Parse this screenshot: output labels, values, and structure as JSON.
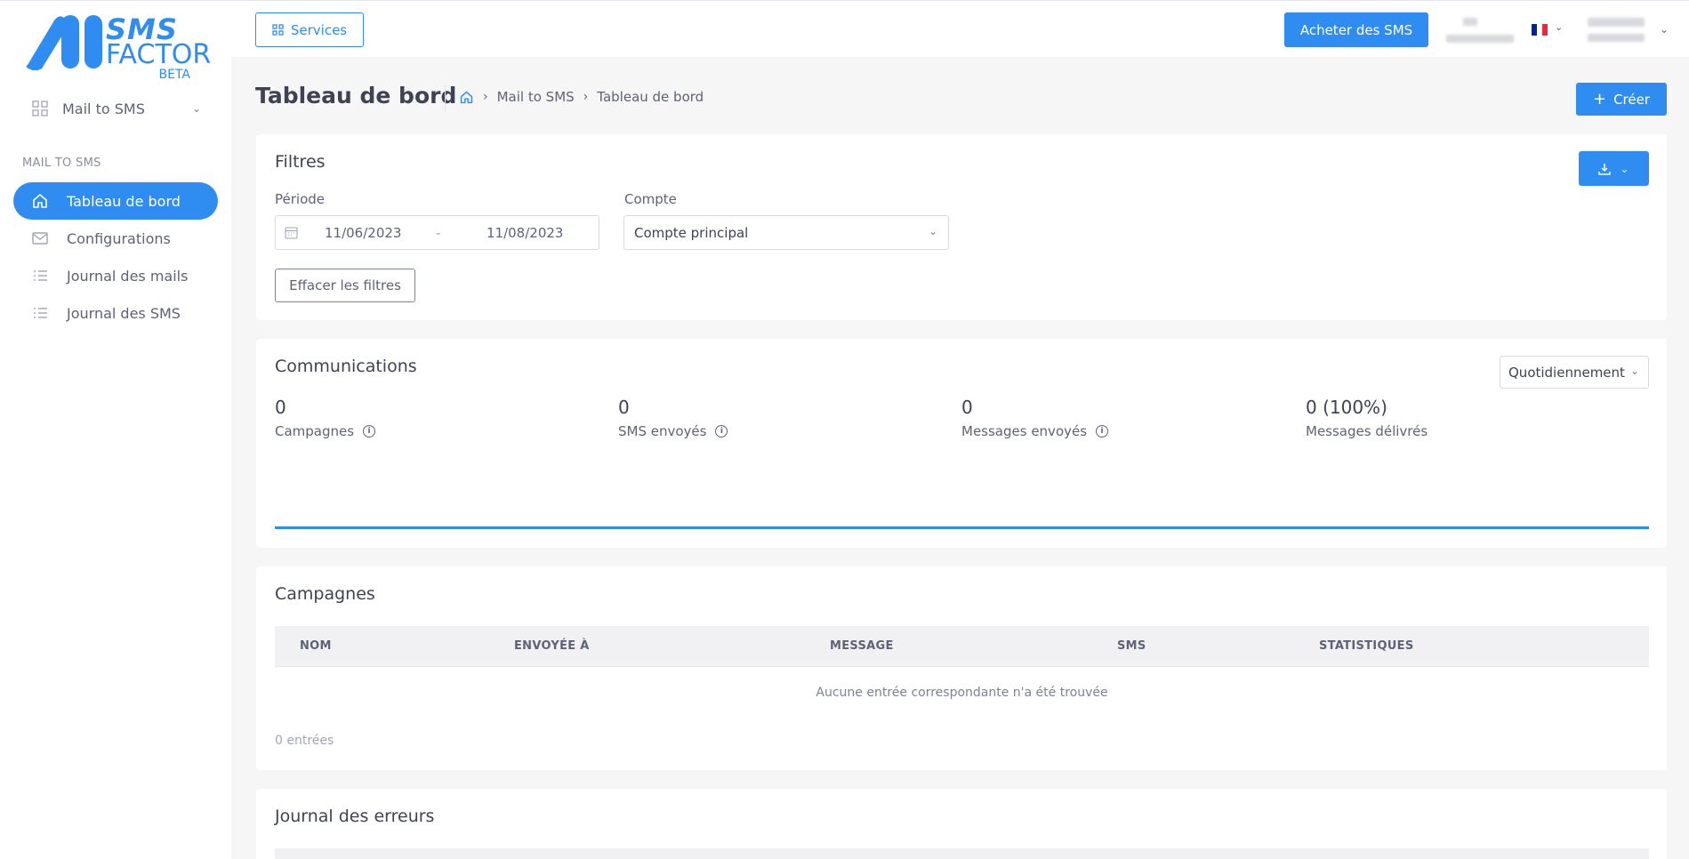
{
  "brand": {
    "line1": "SMS",
    "line2": "FACTOR",
    "line3": "BETA",
    "color": "#2f8cf0"
  },
  "sidebar": {
    "service_switch": {
      "label": "Mail to SMS",
      "icon": "grid-icon"
    },
    "section_label": "MAIL TO SMS",
    "items": [
      {
        "label": "Tableau de bord",
        "icon": "home-icon",
        "active": true
      },
      {
        "label": "Configurations",
        "icon": "mail-icon",
        "active": false
      },
      {
        "label": "Journal des mails",
        "icon": "list-icon",
        "active": false
      },
      {
        "label": "Journal des SMS",
        "icon": "list-icon",
        "active": false
      }
    ]
  },
  "topbar": {
    "services_label": "Services",
    "buy_label": "Acheter des SMS",
    "language_flag": "fr-flag-icon"
  },
  "header": {
    "title": "Tableau de bord",
    "breadcrumb": [
      "Mail to SMS",
      "Tableau de bord"
    ],
    "create_label": "Créer"
  },
  "filters": {
    "title": "Filtres",
    "period_label": "Période",
    "date_from": "11/06/2023",
    "date_sep": "-",
    "date_to": "11/08/2023",
    "account_label": "Compte",
    "account_value": "Compte principal",
    "clear_label": "Effacer les filtres"
  },
  "communications": {
    "title": "Communications",
    "period_select": "Quotidiennement",
    "stats": [
      {
        "value": "0",
        "label": "Campagnes",
        "info": true
      },
      {
        "value": "0",
        "label": "SMS envoyés",
        "info": true
      },
      {
        "value": "0",
        "label": "Messages envoyés",
        "info": true
      },
      {
        "value": "0 (100%)",
        "label": "Messages délivrés",
        "info": false
      }
    ]
  },
  "campaigns": {
    "title": "Campagnes",
    "columns": [
      "NOM",
      "ENVOYÉE À",
      "MESSAGE",
      "SMS",
      "STATISTIQUES"
    ],
    "empty_text": "Aucune entrée correspondante n'a été trouvée",
    "count_text": "0 entrées"
  },
  "errors": {
    "title": "Journal des erreurs"
  },
  "colors": {
    "primary": "#2f8cf0",
    "background": "#f6f6f7"
  }
}
